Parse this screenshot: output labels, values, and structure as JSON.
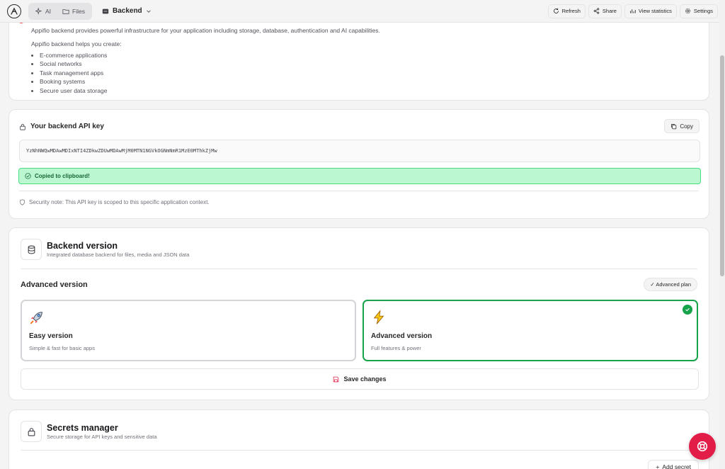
{
  "topbar": {
    "logo_icon": "appifio-logo-icon",
    "ai_label": "AI",
    "files_label": "Files",
    "project_label": "Backend",
    "refresh_label": "Refresh",
    "share_label": "Share",
    "stats_label": "View statistics",
    "settings_label": "Settings"
  },
  "intro": {
    "description": "Appifio backend provides powerful infrastructure for your application including storage, database, authentication and AI capabilities.",
    "helps_label": "Appifio backend helps you create:",
    "items": [
      "E-commerce applications",
      "Social networks",
      "Task management apps",
      "Booking systems",
      "Secure user data storage"
    ]
  },
  "api_key": {
    "title": "Your backend API key",
    "copy_label": "Copy",
    "key_value": "YzNhNWQwMDAwMDIxNTI4ZDkwZDUwMDAwMjM0MTN1NGVkOGNmNmR1MzE0MThkZjMw",
    "toast": "Copied to clipboard!",
    "note": "Security note: This API key is scoped to this specific application context."
  },
  "backend_version": {
    "title": "Backend version",
    "subtitle": "Integrated database backend for files, media and JSON data",
    "current_label": "Advanced version",
    "plan_badge": "✓ Advanced plan",
    "options": [
      {
        "title": "Easy version",
        "subtitle": "Simple & fast for basic apps",
        "icon": "rocket-icon",
        "selected": false
      },
      {
        "title": "Advanced version",
        "subtitle": "Full features & power",
        "icon": "lightning-icon",
        "selected": true
      }
    ],
    "save_label": "Save changes"
  },
  "secrets": {
    "title": "Secrets manager",
    "subtitle": "Secure storage for API keys and sensitive data",
    "add_label": "Add secret"
  },
  "colors": {
    "accent_green": "#16a34a",
    "toast_bg": "#bbf7d0",
    "fab_red": "#e11d48"
  }
}
